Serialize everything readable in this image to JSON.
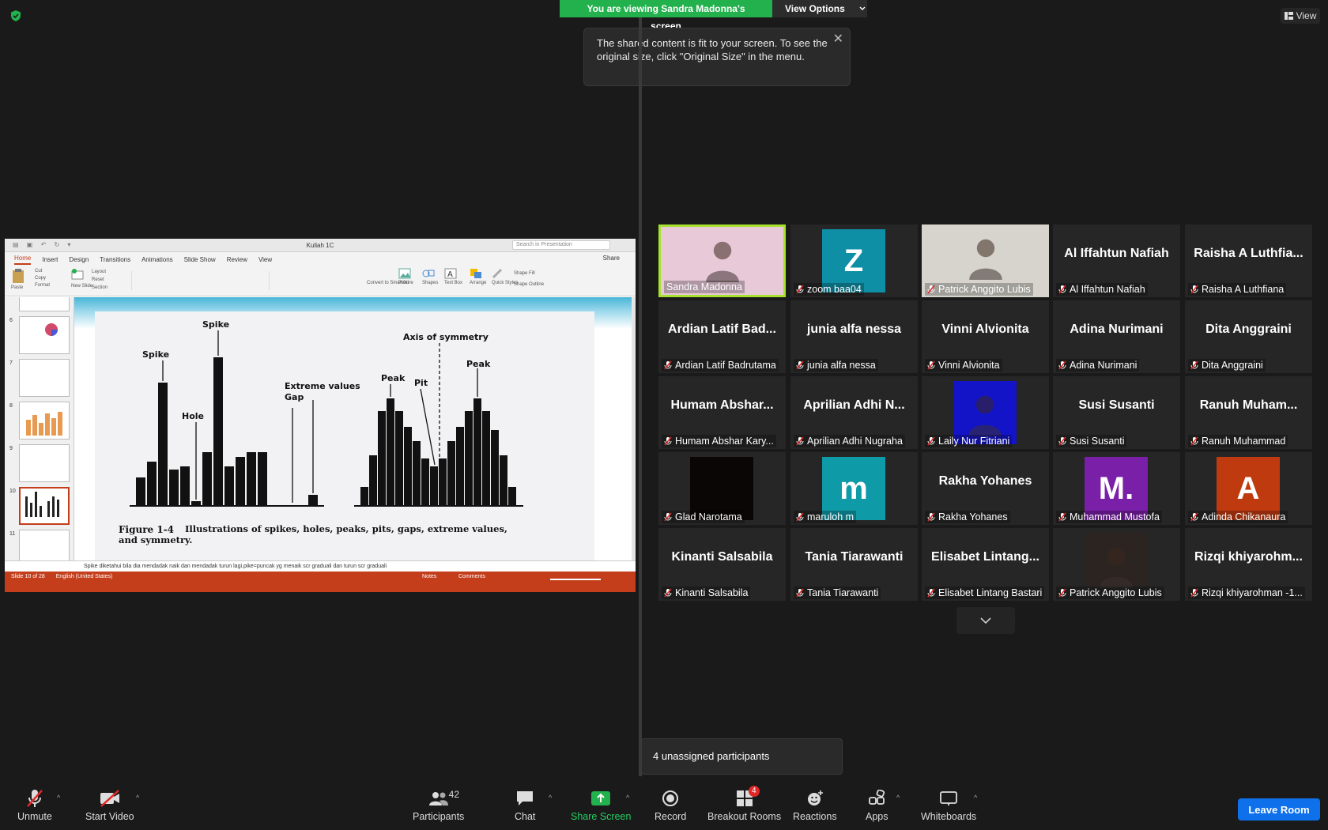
{
  "banner": {
    "viewing": "You are viewing Sandra Madonna's screen",
    "view_options": "View Options"
  },
  "tooltip": {
    "text": "The shared content is fit to your screen. To see the original size, click \"Original Size\" in the menu."
  },
  "view_button": "View",
  "ppt": {
    "title": "Kuliah 1C",
    "search_placeholder": "Search in Presentation",
    "tabs": [
      "Home",
      "Insert",
      "Design",
      "Transitions",
      "Animations",
      "Slide Show",
      "Review",
      "View"
    ],
    "share": "Share",
    "ribbon": {
      "paste": "Paste",
      "cut": "Cut",
      "copy": "Copy",
      "format": "Format",
      "new_slide": "New Slide",
      "layout": "Layout",
      "reset": "Reset",
      "section": "Section",
      "convert": "Convert to SmartArt",
      "picture": "Picture",
      "shapes": "Shapes",
      "text_box": "Text Box",
      "arrange": "Arrange",
      "quick_styles": "Quick Styles",
      "shape_fill": "Shape Fill",
      "shape_outline": "Shape Outline"
    },
    "thumbs": [
      {
        "num": "6"
      },
      {
        "num": "7"
      },
      {
        "num": "8"
      },
      {
        "num": "9"
      },
      {
        "num": "10"
      },
      {
        "num": "11"
      }
    ],
    "figure": {
      "labels": {
        "spike1": "Spike",
        "spike2": "Spike",
        "hole": "Hole",
        "extreme": "Extreme values",
        "gap": "Gap",
        "axis": "Axis of symmetry",
        "peak1": "Peak",
        "pit": "Pit",
        "peak2": "Peak"
      },
      "caption_bold": "Figure 1-4",
      "caption": "Illustrations of spikes, holes, peaks, pits, gaps, extreme values, and symmetry."
    },
    "notes": "Spike diketahui bila dia mendadak naik dan mendadak turun lagi.pike=puncak yg menaik scr graduali dan turun scr graduali",
    "status_slide": "Slide 10 of 28",
    "status_lang": "English (United States)",
    "status_notes": "Notes",
    "status_comments": "Comments"
  },
  "participants": [
    {
      "name": "Sandra Madonna",
      "type": "video",
      "muted": false,
      "speaking": true,
      "bg": "#e8c9d8"
    },
    {
      "name": "zoom baa04",
      "type": "avatar",
      "letter": "Z",
      "color": "#0f8fa6",
      "muted": true
    },
    {
      "name": "Patrick Anggito Lubis",
      "type": "video",
      "muted": true,
      "bg": "#d7d4cd"
    },
    {
      "name": "Al Iffahtun Nafiah",
      "big": "Al Iffahtun Nafiah",
      "type": "text",
      "muted": true
    },
    {
      "name": "Raisha A Luthfiana",
      "big": "Raisha A Luthfia...",
      "type": "text",
      "muted": true
    },
    {
      "name": "Ardian Latif Badrutama",
      "big": "Ardian Latif Bad...",
      "type": "text",
      "muted": true
    },
    {
      "name": "junia alfa nessa",
      "big": "junia alfa nessa",
      "type": "text",
      "muted": true
    },
    {
      "name": "Vinni Alvionita",
      "big": "Vinni Alvionita",
      "type": "text",
      "muted": true
    },
    {
      "name": "Adina Nurimani",
      "big": "Adina Nurimani",
      "type": "text",
      "muted": true
    },
    {
      "name": "Dita Anggraini",
      "big": "Dita Anggraini",
      "type": "text",
      "muted": true
    },
    {
      "name": "Humam Abshar Kary...",
      "big": "Humam Abshar...",
      "type": "text",
      "muted": true
    },
    {
      "name": "Aprilian Adhi Nugraha",
      "big": "Aprilian Adhi N...",
      "type": "text",
      "muted": true
    },
    {
      "name": "Laily Nur Fitriani",
      "type": "video",
      "muted": true,
      "bg": "#1313c8"
    },
    {
      "name": "Susi Susanti",
      "big": "Susi Susanti",
      "type": "text",
      "muted": true
    },
    {
      "name": "Ranuh Muhammad",
      "big": "Ranuh Muham...",
      "type": "text",
      "muted": true
    },
    {
      "name": "Glad Narotama",
      "type": "avatar",
      "letter": "",
      "color": "#0b0606",
      "muted": true
    },
    {
      "name": "maruloh m",
      "type": "avatar",
      "letter": "m",
      "color": "#0f9aa8",
      "muted": true
    },
    {
      "name": "Rakha Yohanes",
      "big": "Rakha Yohanes",
      "type": "text",
      "muted": true
    },
    {
      "name": "Muhammad Mustofa",
      "type": "avatar",
      "letter": "M.",
      "color": "#7a1fa8",
      "muted": true
    },
    {
      "name": "Adinda Chikanaura",
      "type": "avatar",
      "letter": "A",
      "color": "#c03a0f",
      "muted": true
    },
    {
      "name": "Kinanti Salsabila",
      "big": "Kinanti Salsabila",
      "type": "text",
      "muted": true
    },
    {
      "name": "Tania Tiarawanti",
      "big": "Tania Tiarawanti",
      "type": "text",
      "muted": true
    },
    {
      "name": "Elisabet Lintang Bastari",
      "big": "Elisabet Lintang...",
      "type": "text",
      "muted": true
    },
    {
      "name": "Patrick Anggito Lubis",
      "type": "video",
      "muted": true,
      "bg": "#2b2420"
    },
    {
      "name": "Rizqi khiyarohman -1...",
      "big": "Rizqi khiyarohm...",
      "type": "text",
      "muted": true
    }
  ],
  "unassigned": "4 unassigned participants",
  "toolbar": {
    "unmute": "Unmute",
    "start_video": "Start Video",
    "participants": "Participants",
    "participants_count": "42",
    "chat": "Chat",
    "share_screen": "Share Screen",
    "record": "Record",
    "breakout": "Breakout Rooms",
    "breakout_badge": "4",
    "reactions": "Reactions",
    "apps": "Apps",
    "whiteboards": "Whiteboards",
    "leave": "Leave Room"
  }
}
